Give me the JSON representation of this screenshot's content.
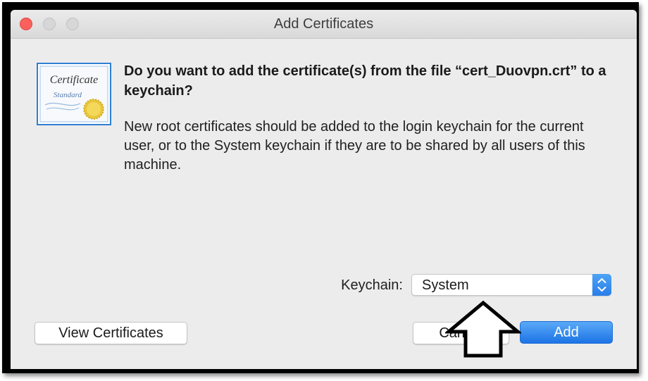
{
  "window": {
    "title": "Add Certificates"
  },
  "certificate_icon": {
    "line1": "Certificate",
    "line2": "Standard"
  },
  "dialog": {
    "heading": "Do you want to add the certificate(s) from the file “cert_Duovpn.crt” to a keychain?",
    "message": "New root certificates should be added to the login keychain for the current user, or to the System keychain if they are to be shared by all users of this machine."
  },
  "keychain": {
    "label": "Keychain:",
    "selected": "System"
  },
  "buttons": {
    "view_certificates": "View Certificates",
    "cancel": "Cancel",
    "add": "Add"
  },
  "colors": {
    "accent": "#2a7ee8",
    "close_button": "#fc605c",
    "window_background": "#ececec"
  },
  "icons": [
    "close-window-icon",
    "minimize-window-icon",
    "zoom-window-icon",
    "certificate-icon",
    "chevron-up-down-icon",
    "up-arrow-annotation-icon"
  ]
}
